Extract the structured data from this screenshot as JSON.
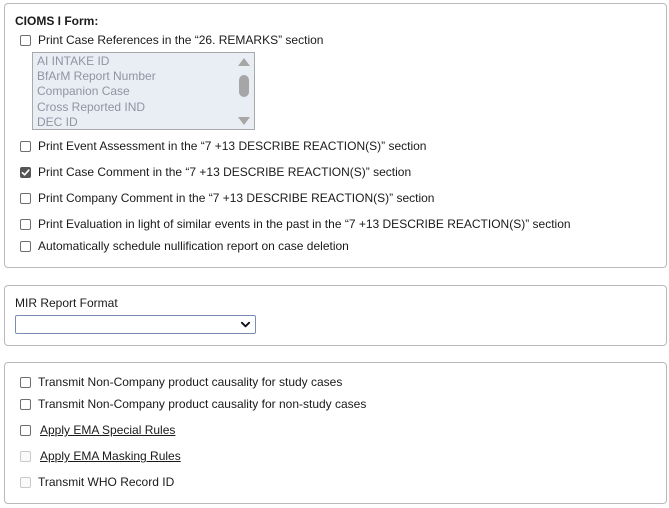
{
  "cioms": {
    "title": "CIOMS I Form:",
    "print_case_refs": {
      "label": "Print Case References in the “26. REMARKS” section",
      "checked": false
    },
    "case_ref_list": [
      "AI INTAKE ID",
      "BfArM Report Number",
      "Companion Case",
      "Cross Reported IND",
      "DEC ID"
    ],
    "options": [
      {
        "label": "Print Event Assessment in the “7 +13 DESCRIBE REACTION(S)” section",
        "checked": false
      },
      {
        "label": "Print Case Comment in the “7 +13 DESCRIBE REACTION(S)” section",
        "checked": true
      },
      {
        "label": "Print Company Comment in the “7 +13 DESCRIBE REACTION(S)” section",
        "checked": false
      },
      {
        "label": "Print Evaluation in light of similar events in the past in the “7 +13 DESCRIBE REACTION(S)” section",
        "checked": false
      },
      {
        "label": "Automatically schedule nullification report on case deletion",
        "checked": false
      }
    ]
  },
  "mir": {
    "label": "MIR Report Format",
    "selected_value": ""
  },
  "transmit": {
    "options": [
      {
        "label": "Transmit Non-Company product causality for study cases",
        "checked": false,
        "disabled": false
      },
      {
        "label": "Transmit Non-Company product causality for non-study cases",
        "checked": false,
        "disabled": false
      },
      {
        "label": "Apply EMA Special Rules",
        "checked": false,
        "disabled": false
      },
      {
        "label": "Apply EMA Masking Rules",
        "checked": false,
        "disabled": true
      },
      {
        "label": "Transmit WHO Record ID",
        "checked": false,
        "disabled": true
      }
    ]
  },
  "colors": {
    "border": "#b9b9b9",
    "checked_fill": "#555555",
    "list_bg": "#e9edf4",
    "list_text": "#8e96a3"
  }
}
